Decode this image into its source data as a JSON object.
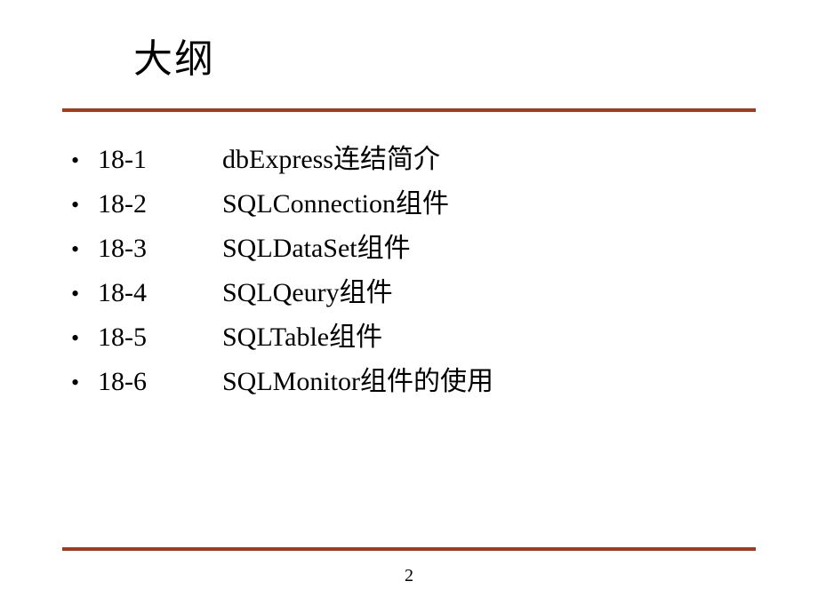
{
  "title": "大纲",
  "items": [
    {
      "num": "18-1",
      "label": "dbExpress连结简介"
    },
    {
      "num": "18-2",
      "label": "SQLConnection组件"
    },
    {
      "num": "18-3",
      "label": "SQLDataSet组件"
    },
    {
      "num": "18-4",
      "label": "SQLQeury组件"
    },
    {
      "num": "18-5",
      "label": "SQLTable组件"
    },
    {
      "num": "18-6",
      "label": "SQLMonitor组件的使用"
    }
  ],
  "page_number": "2",
  "bullet_char": "•",
  "colors": {
    "divider": "#a23b1e"
  }
}
